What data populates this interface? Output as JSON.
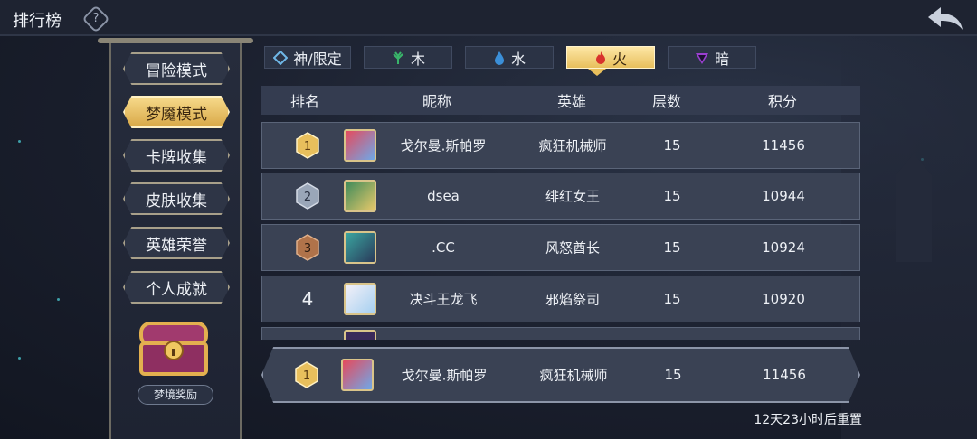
{
  "header": {
    "title": "排行榜",
    "help_symbol": "?"
  },
  "sidebar": {
    "items": [
      {
        "label": "冒险模式",
        "active": false
      },
      {
        "label": "梦魇模式",
        "active": true
      },
      {
        "label": "卡牌收集",
        "active": false
      },
      {
        "label": "皮肤收集",
        "active": false
      },
      {
        "label": "英雄荣誉",
        "active": false
      },
      {
        "label": "个人成就",
        "active": false
      }
    ],
    "reward_label": "梦境奖励"
  },
  "tabs": [
    {
      "label": "神/限定",
      "icon": "diamond-icon",
      "active": false
    },
    {
      "label": "木",
      "icon": "leaf-icon",
      "active": false
    },
    {
      "label": "水",
      "icon": "water-drop-icon",
      "active": false
    },
    {
      "label": "火",
      "icon": "flame-icon",
      "active": true
    },
    {
      "label": "暗",
      "icon": "dark-triangle-icon",
      "active": false
    }
  ],
  "table": {
    "headers": [
      "排名",
      "昵称",
      "英雄",
      "层数",
      "积分"
    ],
    "rows": [
      {
        "rank": "1",
        "name": "戈尔曼.斯帕罗",
        "hero": "疯狂机械师",
        "floors": "15",
        "score": "11456"
      },
      {
        "rank": "2",
        "name": "dsea",
        "hero": "绯红女王",
        "floors": "15",
        "score": "10944"
      },
      {
        "rank": "3",
        "name": ".CC",
        "hero": "风怒酋长",
        "floors": "15",
        "score": "10924"
      },
      {
        "rank": "4",
        "name": "决斗王龙飞",
        "hero": "邪焰祭司",
        "floors": "15",
        "score": "10920"
      }
    ]
  },
  "my_entry": {
    "rank": "1",
    "name": "戈尔曼.斯帕罗",
    "hero": "疯狂机械师",
    "floors": "15",
    "score": "11456"
  },
  "reset_text": "12天23小时后重置",
  "colors": {
    "gold": "#e8bf5c",
    "silver": "#9aa6b8",
    "bronze": "#b0734a",
    "panel": "#3a4254"
  }
}
